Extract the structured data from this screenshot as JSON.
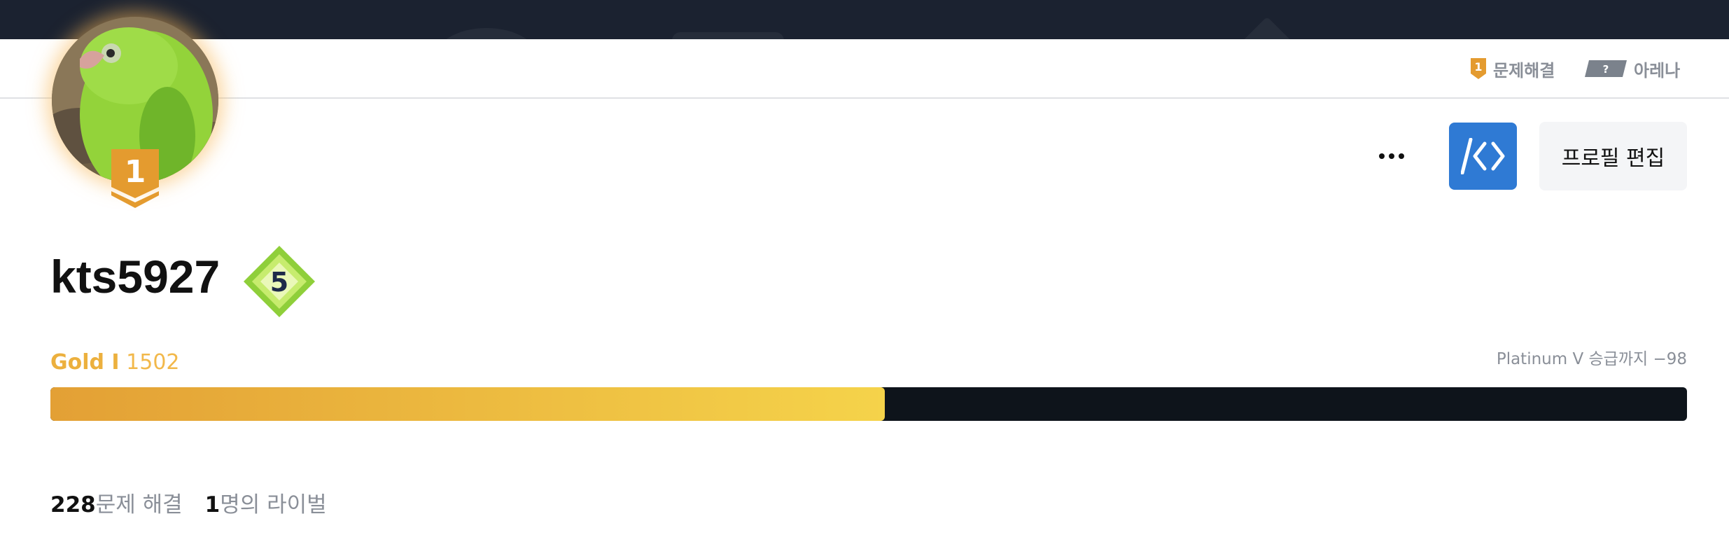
{
  "header": {
    "solved_link": {
      "label": "문제해결",
      "tier_number": "1",
      "icon": "gold-tier-icon"
    },
    "arena_link": {
      "label": "아레나",
      "mark": "?",
      "icon": "arena-unrated-icon"
    }
  },
  "profile": {
    "avatar_badge_number": "1",
    "username": "kts5927",
    "class_level": "5",
    "actions": {
      "more_icon": "more-dots-icon",
      "code_icon": "code-brackets-icon",
      "edit_label": "프로필 편집"
    }
  },
  "rating": {
    "tier": "Gold I",
    "score": "1502",
    "promotion_text": "Platinum V 승급까지 −98",
    "progress_fraction": 0.51,
    "colors": {
      "fill_start": "#e3a035",
      "fill_end": "#f5d34a",
      "track": "#0e141b"
    }
  },
  "stats": {
    "solved_count": "228",
    "solved_label": "문제 해결",
    "rival_count": "1",
    "rival_label": "명의 라이벌"
  }
}
